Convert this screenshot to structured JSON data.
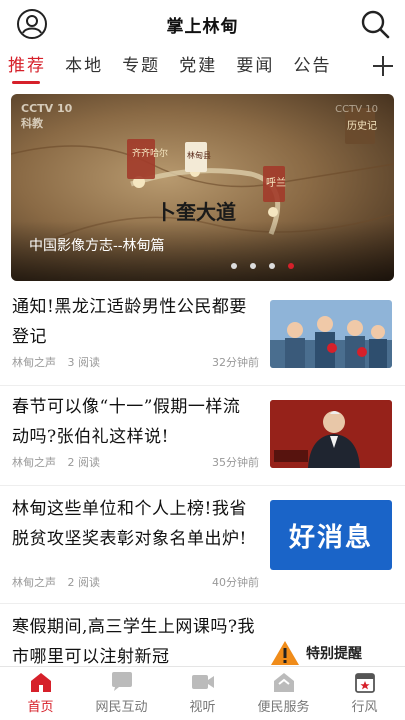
{
  "header": {
    "title": "掌上林甸"
  },
  "tabs": [
    "推荐",
    "本地",
    "专题",
    "党建",
    "要闻",
    "公告"
  ],
  "banner": {
    "caption": "中国影像方志--林甸篇",
    "logo": "CCTV 10",
    "logo_sub": "科教",
    "logo2": "CCTV 10",
    "map_labels": [
      "齐齐哈尔",
      "林甸县",
      "卜奎大道",
      "呼兰",
      "历史记"
    ],
    "dots": 4,
    "active_dot": 3
  },
  "news": [
    {
      "title": "通知!黑龙江适龄男性公民都要登记",
      "source": "林甸之声",
      "reads": "3 阅读",
      "time": "32分钟前"
    },
    {
      "title": "春节可以像“十一”假期一样流动吗?张伯礼这样说!",
      "source": "林甸之声",
      "reads": "2 阅读",
      "time": "35分钟前"
    },
    {
      "title": "林甸这些单位和个人上榜!我省脱贫攻坚奖表彰对象名单出炉!",
      "source": "林甸之声",
      "reads": "2 阅读",
      "time": "40分钟前"
    },
    {
      "title": "寒假期间,高三学生上网课吗?我市哪里可以注射新冠",
      "source": "",
      "reads": "",
      "time": ""
    }
  ],
  "thumbs": {
    "good_news": "好消息",
    "notice": "特别提醒"
  },
  "bottom_nav": [
    {
      "label": "首页",
      "icon": "home-icon"
    },
    {
      "label": "网民互动",
      "icon": "chat-icon"
    },
    {
      "label": "视听",
      "icon": "video-icon"
    },
    {
      "label": "便民服务",
      "icon": "service-icon"
    },
    {
      "label": "行风",
      "icon": "calendar-star-icon"
    }
  ],
  "colors": {
    "accent": "#d6202a",
    "muted": "#999999",
    "good_news_bg": "#1a64c8"
  }
}
